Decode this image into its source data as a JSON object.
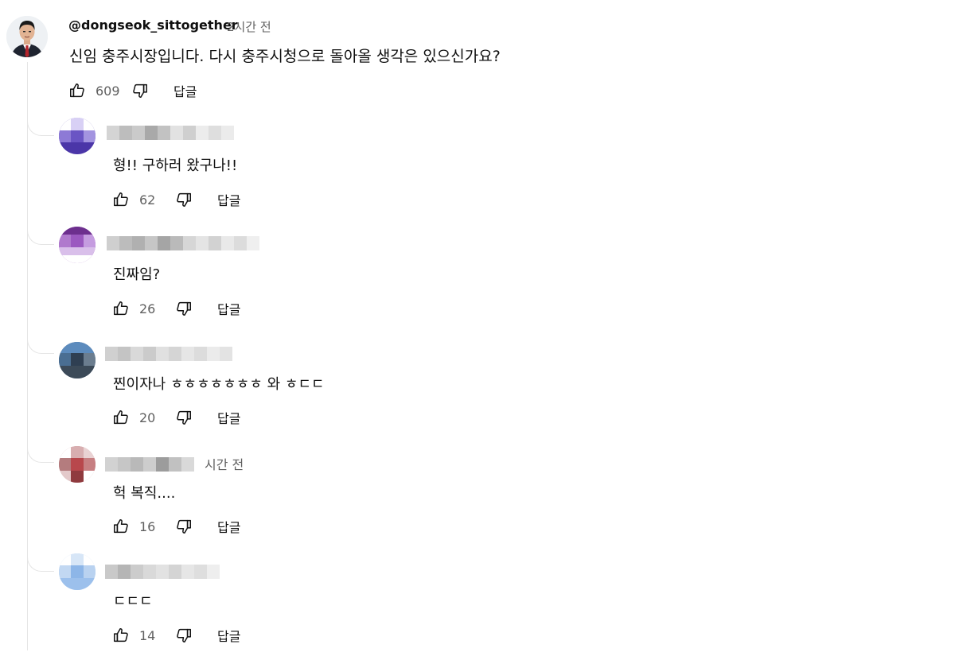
{
  "comment": {
    "author": "@dongseok_sittogether",
    "time": "2시간 전",
    "text": "신임 충주시장입니다. 다시 충주시청으로 돌아올 생각은 있으신가요?",
    "likes": "609",
    "reply_label": "답글"
  },
  "replies": [
    {
      "text": "형!! 구하러 왔구나!!",
      "likes": "62",
      "reply_label": "답글"
    },
    {
      "text": "진짜임?",
      "likes": "26",
      "reply_label": "답글"
    },
    {
      "text": "찐이자나 ㅎㅎㅎㅎㅎㅎㅎ 와 ㅎㄷㄷ",
      "likes": "20",
      "reply_label": "답글"
    },
    {
      "text": "헉 복직....",
      "likes": "16",
      "reply_label": "답글",
      "time_partial": "시간 전"
    },
    {
      "text": "ㄷㄷㄷ",
      "likes": "14",
      "reply_label": "답글"
    }
  ],
  "icons": {
    "like": "thumbs-up-icon",
    "dislike": "thumbs-down-icon"
  },
  "colors": {
    "text_primary": "#0f0f0f",
    "text_secondary": "#606060",
    "thread_line": "#e5e5e5"
  }
}
